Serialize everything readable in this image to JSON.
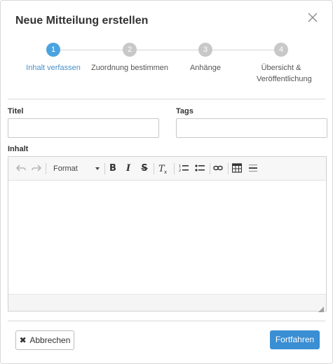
{
  "dialog": {
    "title": "Neue Mitteilung erstellen"
  },
  "steps": [
    {
      "number": "1",
      "label": "Inhalt verfassen",
      "active": true
    },
    {
      "number": "2",
      "label": "Zuordnung bestimmen",
      "active": false
    },
    {
      "number": "3",
      "label": "Anhänge",
      "active": false
    },
    {
      "number": "4",
      "label": "Übersicht & Veröffentlichung",
      "active": false
    }
  ],
  "form": {
    "titel_label": "Titel",
    "titel_value": "",
    "tags_label": "Tags",
    "tags_value": "",
    "inhalt_label": "Inhalt"
  },
  "editor": {
    "format_label": "Format",
    "tools": [
      "undo-icon",
      "redo-icon",
      "bold-icon",
      "italic-icon",
      "strikethrough-icon",
      "remove-format-icon",
      "numbered-list-icon",
      "bulleted-list-icon",
      "link-icon",
      "table-icon",
      "horizontal-line-icon"
    ]
  },
  "footer": {
    "cancel_label": "Abbrechen",
    "next_label": "Fortfahren"
  },
  "colors": {
    "accent": "#3a8ed3",
    "active_step": "#4aa3e0",
    "inactive_step": "#c8c8c8"
  }
}
